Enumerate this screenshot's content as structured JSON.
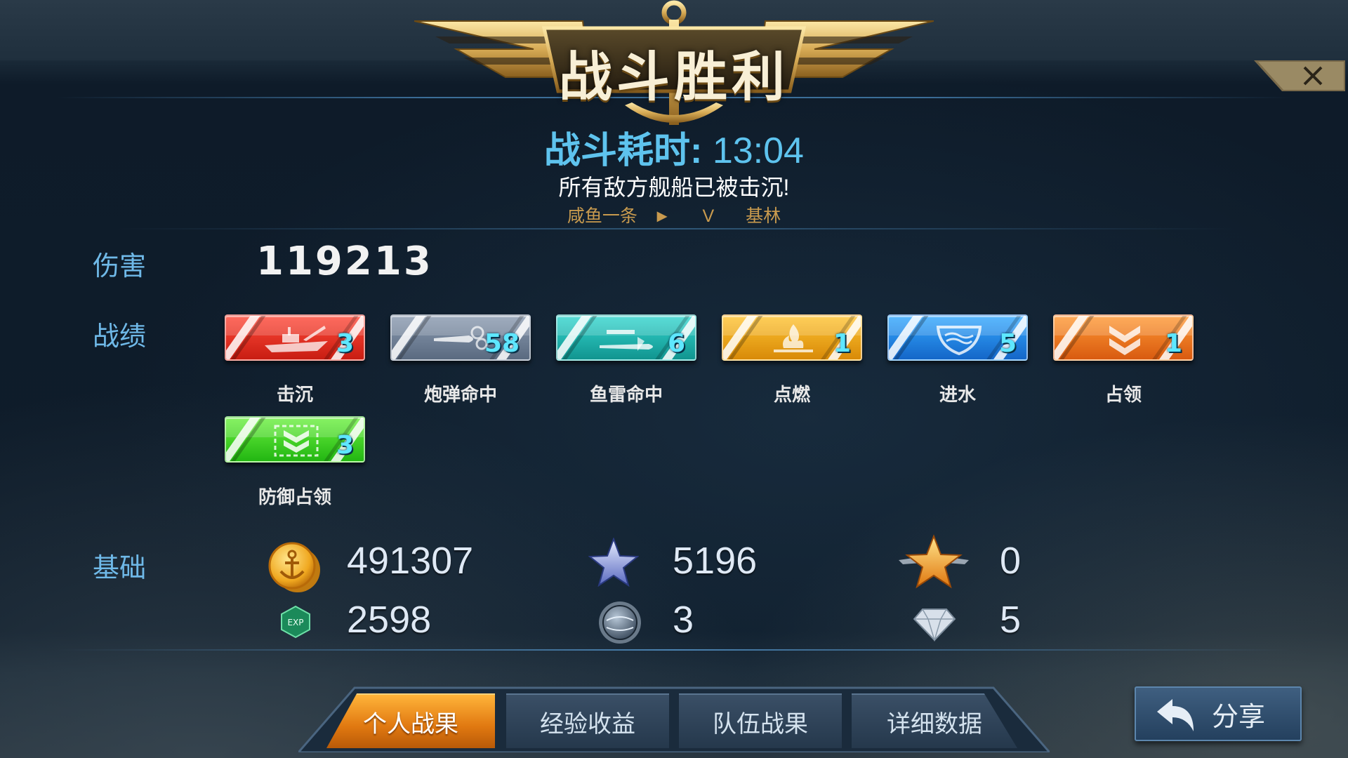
{
  "header": {
    "title": "战斗胜利",
    "duration_label": "战斗耗时:",
    "duration_value": "13:04",
    "subtitle": "所有敌方舰船已被击沉!",
    "player_name": "咸鱼一条",
    "versus": "V",
    "opponent_name": "基林"
  },
  "damage": {
    "label": "伤害",
    "value": "119213"
  },
  "achievements": {
    "label": "战绩",
    "items": [
      {
        "name": "击沉",
        "count": "3",
        "color": "#e0281a",
        "icon": "ship-icon"
      },
      {
        "name": "炮弹命中",
        "count": "58",
        "color": "#6f7f95",
        "icon": "shell-icon"
      },
      {
        "name": "鱼雷命中",
        "count": "6",
        "color": "#1fb8b2",
        "icon": "torpedo-icon"
      },
      {
        "name": "点燃",
        "count": "1",
        "color": "#f0a81a",
        "icon": "fire-icon"
      },
      {
        "name": "进水",
        "count": "5",
        "color": "#1e86e8",
        "icon": "flood-icon"
      },
      {
        "name": "占领",
        "count": "1",
        "color": "#f07822",
        "icon": "capture-icon"
      },
      {
        "name": "防御占领",
        "count": "3",
        "color": "#3cd426",
        "icon": "defend-capture-icon"
      }
    ]
  },
  "base": {
    "label": "基础",
    "coins": "491307",
    "exp": "2598",
    "star_points": "5196",
    "globe": "3",
    "gold_star": "0",
    "diamond": "5",
    "icons": {
      "coins": "anchor-coin-icon",
      "exp": "exp-icon",
      "star_points": "silver-star-icon",
      "globe": "globe-icon",
      "gold_star": "gold-winged-star-icon",
      "diamond": "diamond-icon"
    }
  },
  "tabs": [
    {
      "label": "个人战果",
      "active": true
    },
    {
      "label": "经验收益",
      "active": false
    },
    {
      "label": "队伍战果",
      "active": false
    },
    {
      "label": "详细数据",
      "active": false
    }
  ],
  "share_label": "分享",
  "colors": {
    "accent_blue": "#5ec3ee",
    "label_blue": "#6fb9e8",
    "gold": "#c89a4e",
    "active_tab": "#e07810"
  }
}
